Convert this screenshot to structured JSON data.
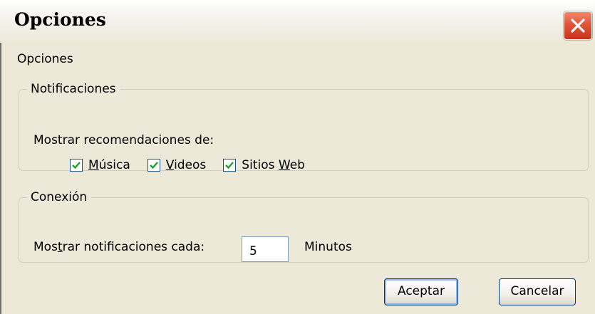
{
  "window": {
    "title": "Opciones"
  },
  "content": {
    "section_label": "Opciones",
    "notifications": {
      "legend": "Notificaciones",
      "prompt": "Mostrar recomendaciones de:",
      "options": [
        {
          "pre": "",
          "u": "M",
          "post": "úsica",
          "checked": true
        },
        {
          "pre": "",
          "u": "V",
          "post": "ideos",
          "checked": true
        },
        {
          "pre": "Sitios ",
          "u": "W",
          "post": "eb",
          "checked": true
        }
      ]
    },
    "connection": {
      "legend": "Conexión",
      "label_pre": "Mos",
      "label_u": "t",
      "label_post": "rar notificaciones cada:",
      "interval_value": "5",
      "unit": "Minutos"
    }
  },
  "buttons": {
    "ok": "Aceptar",
    "cancel": "Cancelar"
  },
  "colors": {
    "checkmark": "#21a121",
    "close_button": "#e0553a",
    "dialog_background": "#ece9d8"
  }
}
